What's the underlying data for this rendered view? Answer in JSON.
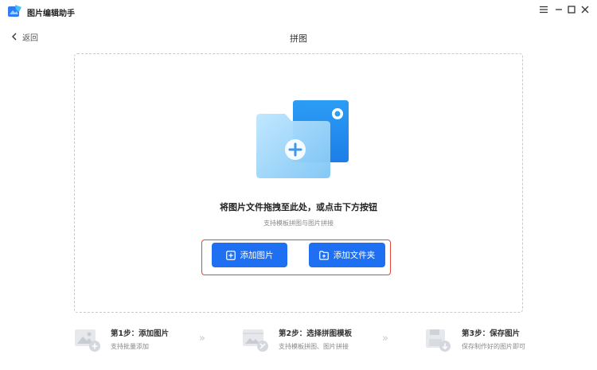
{
  "app": {
    "title": "图片编辑助手"
  },
  "nav": {
    "back_label": "返回",
    "page_title": "拼图"
  },
  "dropzone": {
    "main_text": "将图片文件拖拽至此处，或点击下方按钮",
    "sub_text": "支持模板拼图与图片拼接",
    "add_image_label": "添加图片",
    "add_folder_label": "添加文件夹"
  },
  "steps": [
    {
      "title": "第1步：添加图片",
      "desc": "支持批量添加",
      "icon": "image-add-icon"
    },
    {
      "title": "第2步：选择拼图模板",
      "desc": "支持模板拼图、图片拼接",
      "icon": "template-icon"
    },
    {
      "title": "第3步：保存图片",
      "desc": "保存制作好的图片即可",
      "icon": "save-icon"
    }
  ],
  "colors": {
    "primary": "#1f6ff2",
    "highlight": "#e0463a",
    "dashed_border": "#c9c9c9"
  }
}
